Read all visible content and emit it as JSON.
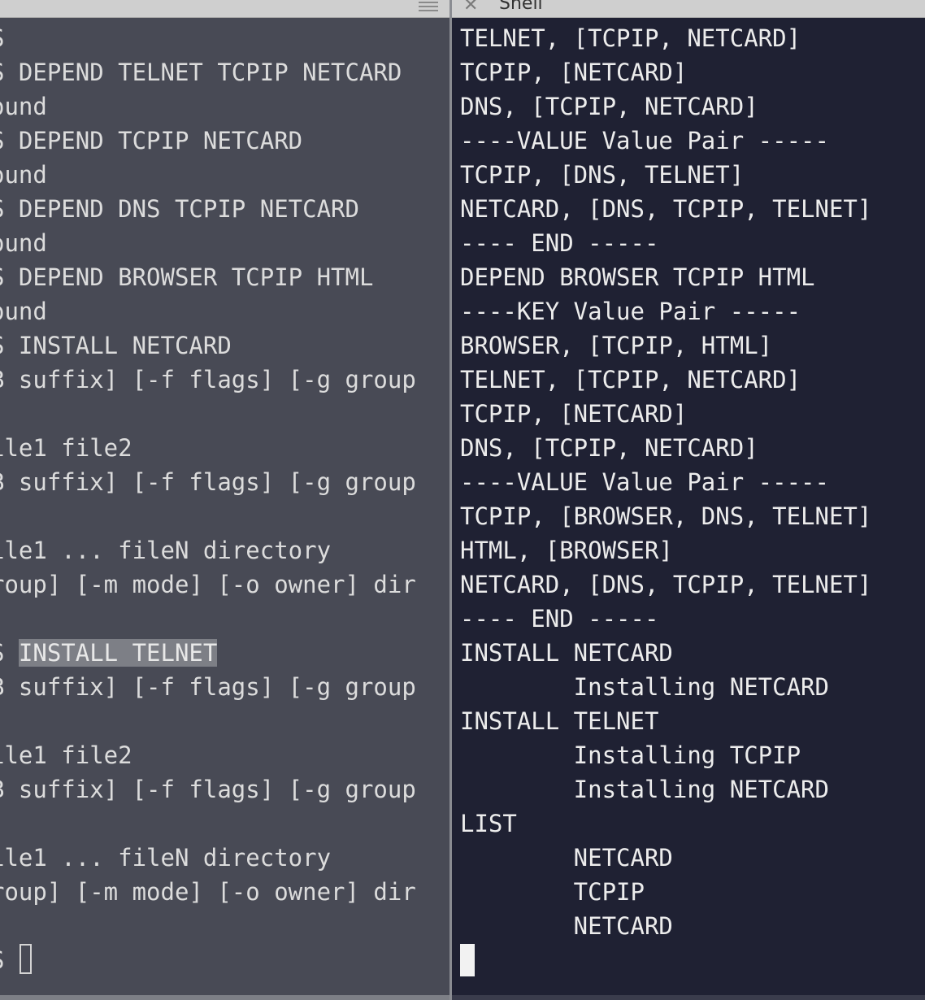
{
  "left_pane": {
    "lines": [
      "S",
      "S DEPEND TELNET TCPIP NETCARD",
      "ound",
      "S DEPEND TCPIP NETCARD",
      "ound",
      "S DEPEND DNS TCPIP NETCARD",
      "ound",
      "S DEPEND BROWSER TCPIP HTML",
      "ound",
      "S INSTALL NETCARD",
      "B suffix] [-f flags] [-g group",
      "",
      "ile1 file2",
      "B suffix] [-f flags] [-g group",
      "",
      "ile1 ... fileN directory",
      "roup] [-m mode] [-o owner] dir",
      "",
      "S ",
      "B suffix] [-f flags] [-g group",
      "",
      "ile1 file2",
      "B suffix] [-f flags] [-g group",
      "",
      "ile1 ... fileN directory",
      "roup] [-m mode] [-o owner] dir",
      "",
      "S "
    ],
    "highlighted_command": "INSTALL TELNET"
  },
  "right_pane": {
    "tab_title": "Shell",
    "lines": [
      "TELNET, [TCPIP, NETCARD]",
      "TCPIP, [NETCARD]",
      "DNS, [TCPIP, NETCARD]",
      "----VALUE Value Pair -----",
      "TCPIP, [DNS, TELNET]",
      "NETCARD, [DNS, TCPIP, TELNET]",
      "---- END -----",
      "DEPEND BROWSER TCPIP HTML",
      "----KEY Value Pair -----",
      "BROWSER, [TCPIP, HTML]",
      "TELNET, [TCPIP, NETCARD]",
      "TCPIP, [NETCARD]",
      "DNS, [TCPIP, NETCARD]",
      "----VALUE Value Pair -----",
      "TCPIP, [BROWSER, DNS, TELNET]",
      "HTML, [BROWSER]",
      "NETCARD, [DNS, TCPIP, TELNET]",
      "---- END -----",
      "INSTALL NETCARD",
      "        Installing NETCARD",
      "INSTALL TELNET",
      "        Installing TCPIP",
      "        Installing NETCARD",
      "LIST",
      "        NETCARD",
      "        TCPIP",
      "        NETCARD"
    ]
  },
  "colors": {
    "left_background": "#484a55",
    "right_background": "#1f2133",
    "highlight": "#7d7f86"
  }
}
